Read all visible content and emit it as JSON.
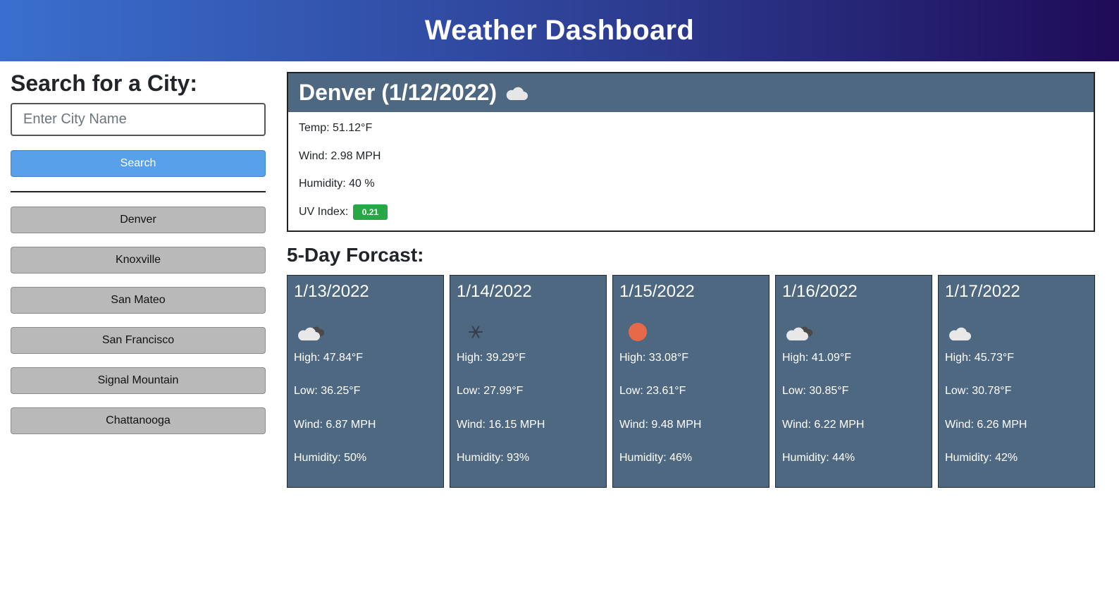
{
  "header": {
    "title": "Weather Dashboard"
  },
  "sidebar": {
    "heading": "Search for a City:",
    "input_placeholder": "Enter City Name",
    "search_label": "Search",
    "history": [
      "Denver",
      "Knoxville",
      "San Mateo",
      "San Francisco",
      "Signal Mountain",
      "Chattanooga"
    ]
  },
  "current": {
    "heading": "Denver (1/12/2022)",
    "icon": "cloud-icon",
    "temp": "Temp: 51.12°F",
    "wind": "Wind: 2.98 MPH",
    "humidity": "Humidity: 40 %",
    "uv_label": "UV Index:",
    "uv_value": "0.21",
    "uv_color": "#28a745"
  },
  "forecast": {
    "title": "5-Day Forcast:",
    "days": [
      {
        "date": "1/13/2022",
        "icon": "cloud-dark-icon",
        "high": "High: 47.84°F",
        "low": "Low: 36.25°F",
        "wind": "Wind: 6.87 MPH",
        "humidity": "Humidity: 50%"
      },
      {
        "date": "1/14/2022",
        "icon": "snowflake-icon",
        "high": "High: 39.29°F",
        "low": "Low: 27.99°F",
        "wind": "Wind: 16.15 MPH",
        "humidity": "Humidity: 93%"
      },
      {
        "date": "1/15/2022",
        "icon": "sun-icon",
        "high": "High: 33.08°F",
        "low": "Low: 23.61°F",
        "wind": "Wind: 9.48 MPH",
        "humidity": "Humidity: 46%"
      },
      {
        "date": "1/16/2022",
        "icon": "cloud-dark-icon",
        "high": "High: 41.09°F",
        "low": "Low: 30.85°F",
        "wind": "Wind: 6.22 MPH",
        "humidity": "Humidity: 44%"
      },
      {
        "date": "1/17/2022",
        "icon": "cloud-icon",
        "high": "High: 45.73°F",
        "low": "Low: 30.78°F",
        "wind": "Wind: 6.26 MPH",
        "humidity": "Humidity: 42%"
      }
    ]
  },
  "colors": {
    "header_gradient_start": "#3a6fcf",
    "header_gradient_end": "#1f0b58",
    "card_bg": "#4e6882",
    "search_button": "#58a0ea",
    "history_button": "#b9b9b9",
    "sun": "#e8694a"
  }
}
